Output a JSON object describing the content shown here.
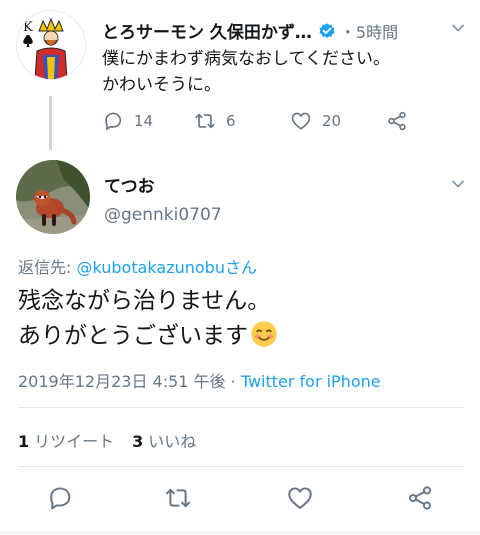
{
  "parent_tweet": {
    "author_name": "とろサーモン 久保田かず…",
    "time": "・5時間",
    "text_line1": "僕にかまわず病気なおしてください。",
    "text_line2": "かわいそうに。",
    "reply_count": "14",
    "retweet_count": "6",
    "like_count": "20"
  },
  "main_tweet": {
    "author_name": "てつお",
    "handle": "@gennki0707",
    "reply_prefix": "返信先: ",
    "reply_mention": "@kubotakazunobuさん",
    "text_line1": "残念ながら治りません。",
    "text_line2": "ありがとうございます",
    "timestamp": "2019年12月23日 4:51 午後 · ",
    "source": "Twitter for iPhone",
    "retweets_count": "1",
    "retweets_label": "リツイート",
    "likes_count": "3",
    "likes_label": "いいね"
  },
  "colors": {
    "accent": "#1da1f2",
    "secondary_text": "#657786",
    "primary_text": "#14171a",
    "divider": "#e1e8ed"
  },
  "icons": [
    "verified-badge-icon",
    "chevron-down-icon",
    "reply-icon",
    "retweet-icon",
    "like-icon",
    "share-icon",
    "smiling-face-emoji"
  ]
}
